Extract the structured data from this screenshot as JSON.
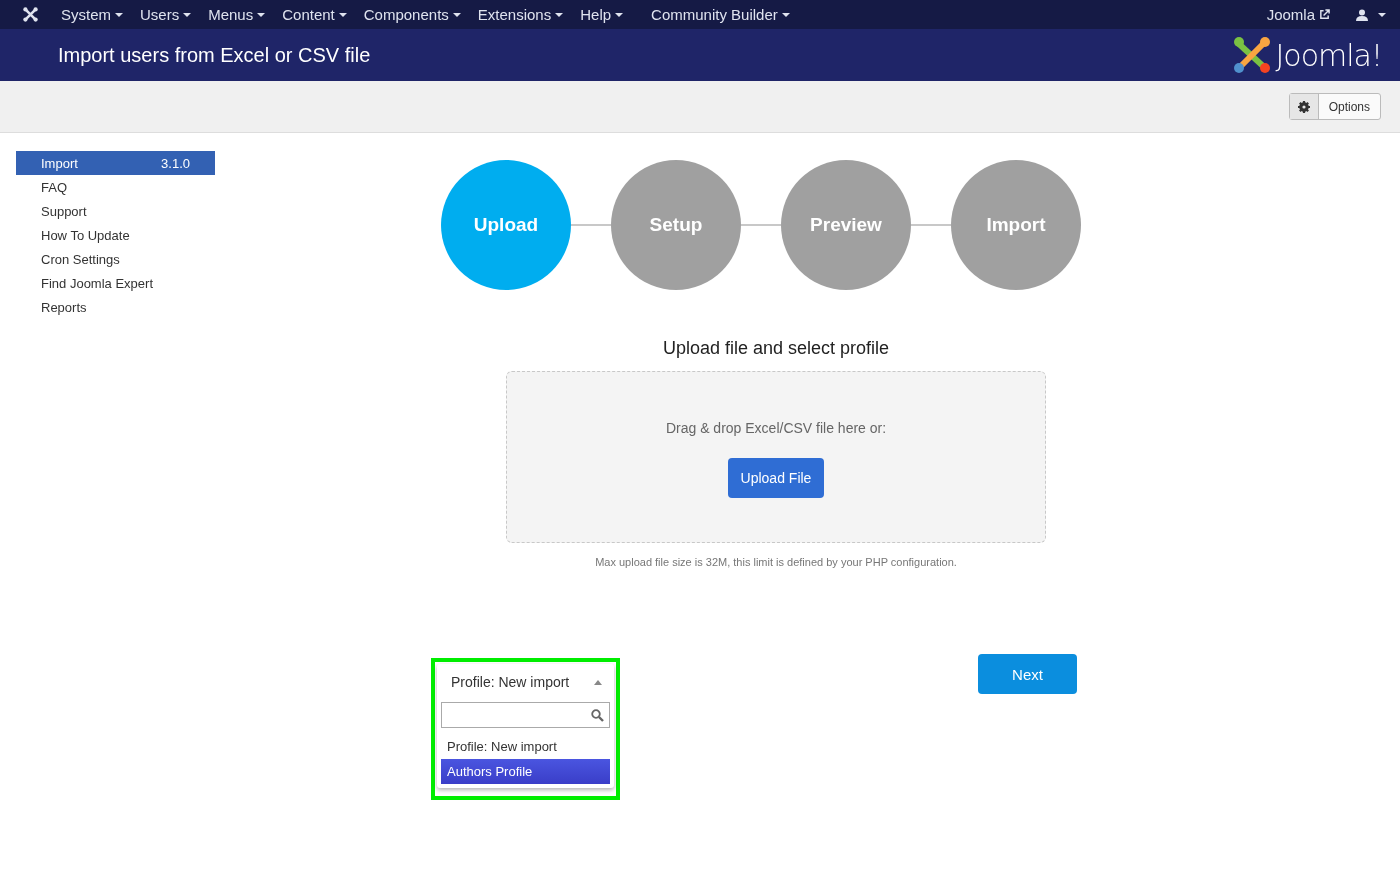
{
  "top_menu": {
    "items": [
      {
        "label": "System"
      },
      {
        "label": "Users"
      },
      {
        "label": "Menus"
      },
      {
        "label": "Content"
      },
      {
        "label": "Components"
      },
      {
        "label": "Extensions"
      },
      {
        "label": "Help"
      },
      {
        "label": "Community Builder"
      }
    ],
    "site_link": "Joomla"
  },
  "header": {
    "title": "Import users from Excel or CSV file",
    "logo_text": "Joomla!"
  },
  "toolbar": {
    "options_button": "Options"
  },
  "sidebar": {
    "items": [
      {
        "label": "Import",
        "badge": "3.1.0",
        "selected": true
      },
      {
        "label": "FAQ",
        "selected": false
      },
      {
        "label": "Support",
        "selected": false
      },
      {
        "label": "How To Update",
        "selected": false
      },
      {
        "label": "Cron Settings",
        "selected": false
      },
      {
        "label": "Find Joomla Expert",
        "selected": false
      },
      {
        "label": "Reports",
        "selected": false
      }
    ]
  },
  "steps": [
    {
      "label": "Upload",
      "selected": true
    },
    {
      "label": "Setup",
      "selected": false
    },
    {
      "label": "Preview",
      "selected": false
    },
    {
      "label": "Import",
      "selected": false
    }
  ],
  "upload": {
    "heading": "Upload file and select profile",
    "drop_text": "Drag & drop Excel/CSV file here or:",
    "button": "Upload File",
    "note": "Max upload file size is 32M, this limit is defined by your PHP configuration."
  },
  "profile_select": {
    "value": "Profile: New import",
    "expanded": true,
    "options": [
      {
        "label": "Profile: New import",
        "highlighted": false
      },
      {
        "label": "Authors Profile",
        "highlighted": true
      }
    ]
  },
  "next_button": "Next"
}
